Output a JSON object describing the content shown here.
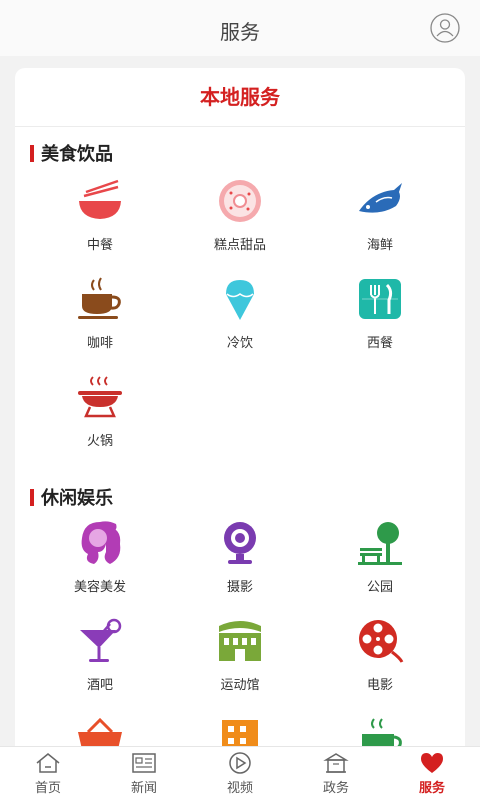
{
  "header": {
    "title": "服务",
    "user_icon": "user-icon"
  },
  "card": {
    "title": "本地服务"
  },
  "sections": [
    {
      "title": "美食饮品",
      "items": [
        {
          "label": "中餐",
          "icon": "bowl-chopsticks-icon"
        },
        {
          "label": "糕点甜品",
          "icon": "donut-icon"
        },
        {
          "label": "海鲜",
          "icon": "fish-icon"
        },
        {
          "label": "咖啡",
          "icon": "coffee-cup-icon"
        },
        {
          "label": "冷饮",
          "icon": "ice-cream-icon"
        },
        {
          "label": "西餐",
          "icon": "fork-knife-icon"
        },
        {
          "label": "火锅",
          "icon": "hotpot-icon"
        }
      ]
    },
    {
      "title": "休闲娱乐",
      "items": [
        {
          "label": "美容美发",
          "icon": "hair-beauty-icon"
        },
        {
          "label": "摄影",
          "icon": "camera-icon"
        },
        {
          "label": "公园",
          "icon": "park-icon"
        },
        {
          "label": "酒吧",
          "icon": "cocktail-icon"
        },
        {
          "label": "运动馆",
          "icon": "stadium-icon"
        },
        {
          "label": "电影",
          "icon": "film-reel-icon"
        }
      ]
    }
  ],
  "tabs": [
    {
      "label": "首页",
      "icon": "home-icon"
    },
    {
      "label": "新闻",
      "icon": "news-icon"
    },
    {
      "label": "视频",
      "icon": "video-icon"
    },
    {
      "label": "政务",
      "icon": "government-icon"
    },
    {
      "label": "服务",
      "icon": "heart-icon",
      "active": true
    }
  ],
  "colors": {
    "accent": "#d42020",
    "background": "#f2f2f2"
  }
}
